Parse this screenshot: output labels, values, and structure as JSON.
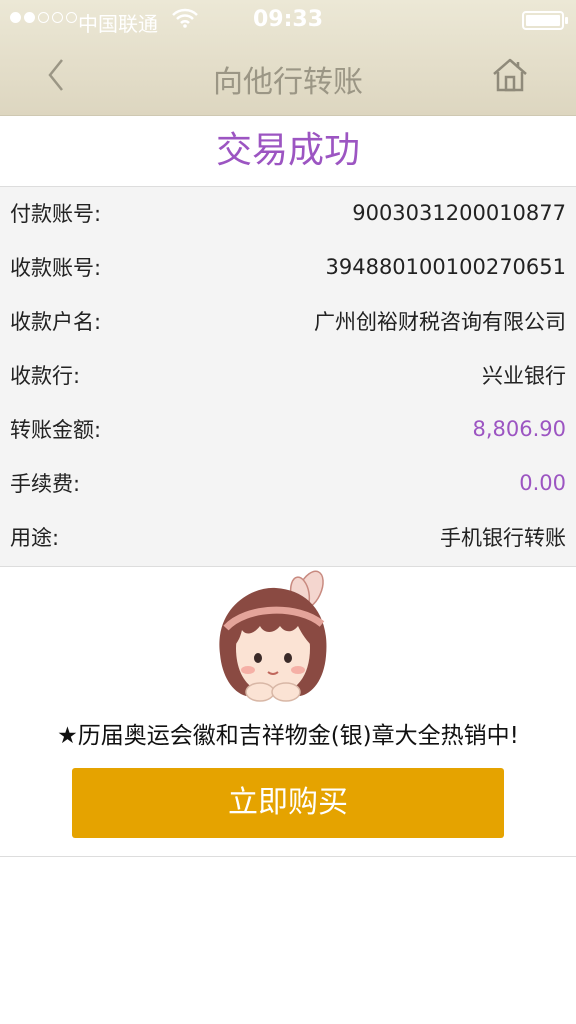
{
  "status_bar": {
    "carrier": "中国联通",
    "time": "09:33",
    "signal_bars": 2,
    "signal_total": 5
  },
  "nav": {
    "title": "向他行转账",
    "back_icon": "chevron-left-icon",
    "home_icon": "home-icon"
  },
  "result": {
    "title": "交易成功"
  },
  "details": [
    {
      "label": "付款账号:",
      "value": "9003031200010877",
      "highlight": false
    },
    {
      "label": "收款账号:",
      "value": "394880100100270651",
      "highlight": false
    },
    {
      "label": "收款户名:",
      "value": "广州创裕财税咨询有限公司",
      "highlight": false
    },
    {
      "label": "收款行:",
      "value": "兴业银行",
      "highlight": false
    },
    {
      "label": "转账金额:",
      "value": "8,806.90",
      "highlight": true
    },
    {
      "label": "手续费:",
      "value": "0.00",
      "highlight": true
    },
    {
      "label": "用途:",
      "value": "手机银行转账",
      "highlight": false
    }
  ],
  "promo": {
    "text": "★历届奥运会徽和吉祥物金(银)章大全热销中!",
    "button_label": "立即购买"
  },
  "colors": {
    "accent_purple": "#9c55c2",
    "button_gold": "#e5a300",
    "nav_background": "#e4dfca"
  }
}
